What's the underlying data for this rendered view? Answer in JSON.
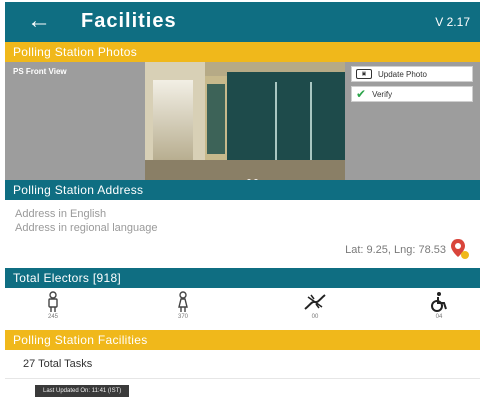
{
  "header": {
    "back_icon": "arrow-left-icon",
    "title": "Facilities",
    "version": "V 2.17"
  },
  "photos_section": {
    "heading": "Polling Station Photos",
    "photo_label": "PS Front View",
    "update_button": "Update Photo",
    "verify_button": "Verify"
  },
  "address_section": {
    "heading": "Polling Station Address",
    "english": "Address in English",
    "regional": "Address in regional language",
    "latlng": "Lat: 9.25, Lng: 78.53"
  },
  "electors_section": {
    "heading": "Total Electors [918]",
    "items": [
      {
        "icon": "male-voter-icon",
        "count": "245"
      },
      {
        "icon": "female-voter-icon",
        "count": "370"
      },
      {
        "icon": "third-gender-icon",
        "count": "00"
      },
      {
        "icon": "wheelchair-icon",
        "count": "04"
      }
    ]
  },
  "facilities_section": {
    "heading": "Polling Station Facilities",
    "tasks": "27 Total Tasks",
    "last_updated": "Last Updated On: 11:41 (IST)"
  },
  "colors": {
    "primary": "#0f6e82",
    "accent": "#f0b81b"
  }
}
